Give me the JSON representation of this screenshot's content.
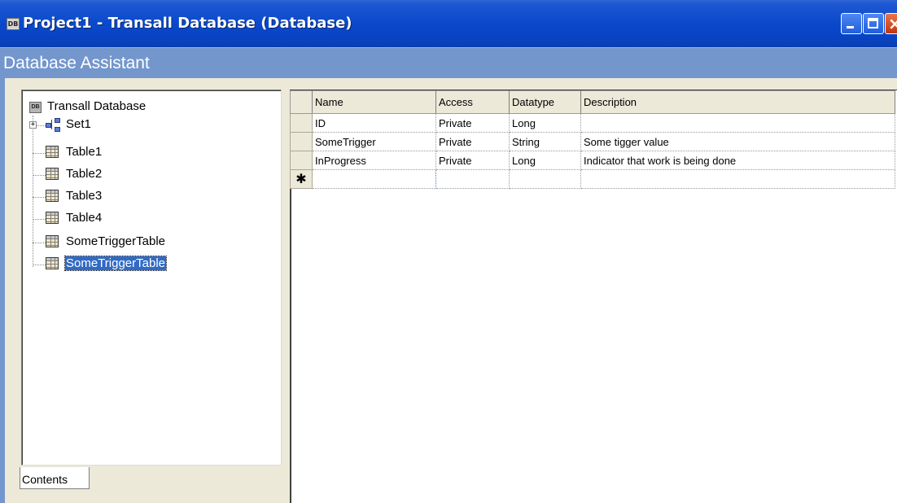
{
  "window": {
    "title": "Project1 - Transall Database (Database)",
    "icon_text": "DB",
    "buttons": {
      "minimize": "minimize",
      "maximize": "maximize",
      "close": "close"
    }
  },
  "assistant": {
    "title": "Database Assistant"
  },
  "tree": {
    "root": {
      "label": "Transall Database",
      "icon": "database-icon",
      "icon_text": "DB"
    },
    "items": [
      {
        "label": "Set1",
        "icon": "set-icon",
        "expandable": true,
        "expander": "+"
      },
      {
        "label": "Table1",
        "icon": "table-icon"
      },
      {
        "label": "Table2",
        "icon": "table-icon"
      },
      {
        "label": "Table3",
        "icon": "table-icon"
      },
      {
        "label": "Table4",
        "icon": "table-icon"
      },
      {
        "label": "SomeTriggerTable",
        "icon": "table-icon"
      },
      {
        "label": "SomeTriggerTable",
        "icon": "table-icon",
        "selected": true
      }
    ]
  },
  "tabs": {
    "contents": "Contents"
  },
  "grid": {
    "columns": [
      "Name",
      "Access",
      "Datatype",
      "Description"
    ],
    "rows": [
      {
        "name": "ID",
        "access": "Private",
        "datatype": "Long",
        "description": ""
      },
      {
        "name": "SomeTrigger",
        "access": "Private",
        "datatype": "String",
        "description": "Some tigger value"
      },
      {
        "name": "InProgress",
        "access": "Private",
        "datatype": "Long",
        "description": "Indicator that work is being done"
      }
    ],
    "new_row_marker": "✱"
  },
  "colors": {
    "titlebar": "#0a49cc",
    "assistant_band": "#7396cd",
    "selection": "#316ac5",
    "panel": "#ece9d8"
  }
}
